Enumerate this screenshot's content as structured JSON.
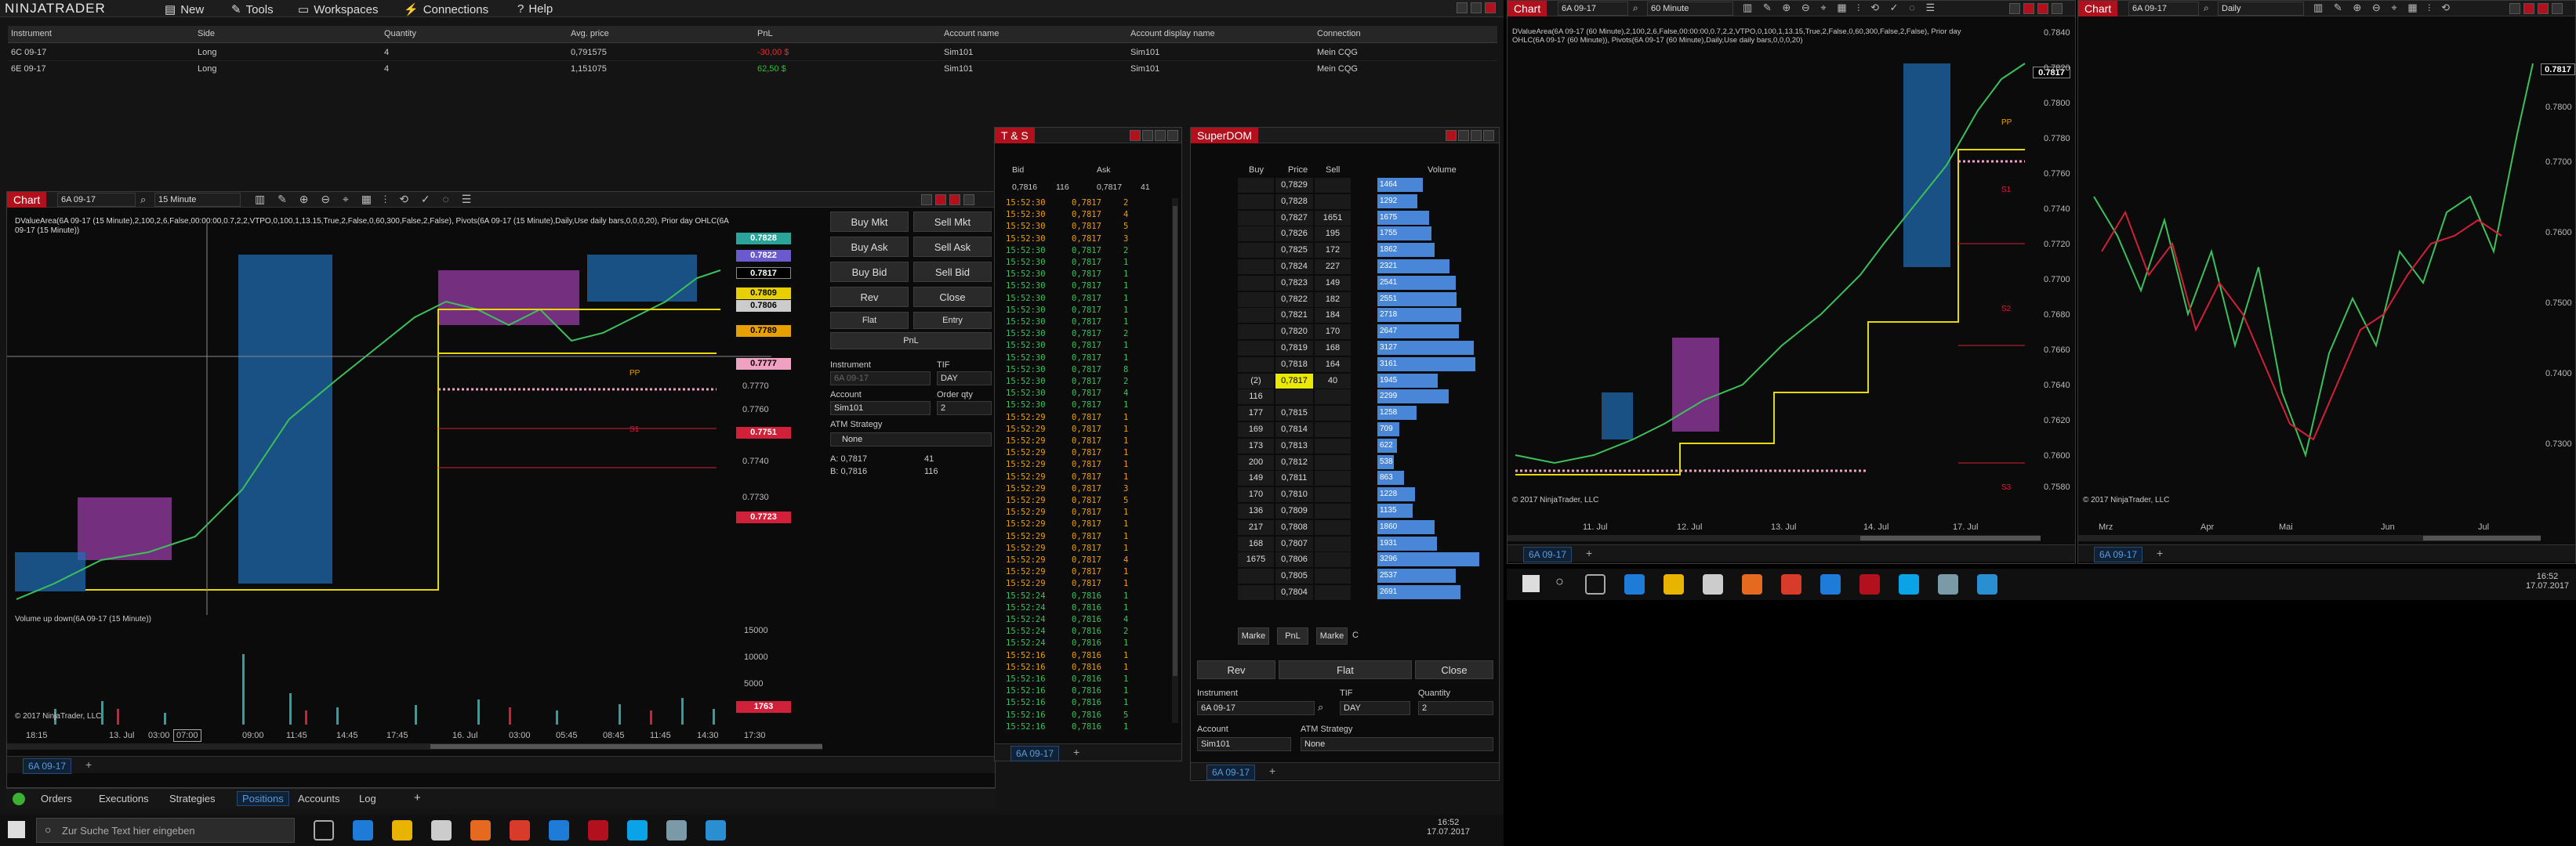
{
  "app": {
    "logo": "NINJATRADER",
    "menu": [
      "New",
      "Tools",
      "Workspaces",
      "Connections",
      "Help"
    ]
  },
  "positions": {
    "headers": [
      "Instrument",
      "Side",
      "Quantity",
      "Avg. price",
      "PnL",
      "Account name",
      "Account display name",
      "Connection"
    ],
    "rows": [
      [
        "6C 09-17",
        "Long",
        "4",
        "0,791575",
        "-30,00 $",
        "Sim101",
        "Sim101",
        "Mein CQG"
      ],
      [
        "6E 09-17",
        "Long",
        "4",
        "1,151075",
        "62,50 $",
        "Sim101",
        "Sim101",
        "Mein CQG"
      ]
    ]
  },
  "chart1": {
    "title": "Chart",
    "instrument": "6A 09-17",
    "interval": "15 Minute",
    "indicator_line": "DValueArea(6A 09-17 (15 Minute),2,100,2,6,False,00:00:00,0.7,2,2,VTPO,0,100,1,13.15,True,2,False,0,60,300,False,2,False), Pivots(6A 09-17 (15 Minute),Daily,Use daily bars,0,0,0,20), Prior day OHLC(6A",
    "indicator_line2": "09-17 (15 Minute))",
    "price_tags": [
      {
        "label": "0.7828",
        "color": "#2aa39a"
      },
      {
        "label": "0.7822",
        "color": "#6a5acd"
      },
      {
        "label": "0.7817",
        "color": "#000000"
      },
      {
        "label": "0.7809",
        "color": "#e8d000"
      },
      {
        "label": "0.7806",
        "color": "#cccccc"
      },
      {
        "label": "0.7789",
        "color": "#e8a000"
      },
      {
        "label": "0.7777",
        "color": "#f0a0c0"
      },
      {
        "label": "0.7751",
        "color": "#d0203a"
      },
      {
        "label": "0.7723",
        "color": "#d0203a"
      }
    ],
    "y_ticks": [
      "0.7770",
      "0.7760",
      "0.7750",
      "0.7740",
      "0.7730"
    ],
    "x_ticks": [
      "18:15",
      "13. Jul",
      "03:00",
      "07:00",
      "09:00",
      "11:45",
      "14:45",
      "17:45",
      "16. Jul",
      "03:00",
      "05:45",
      "08:45",
      "11:45",
      "14:30",
      "17:30"
    ],
    "pp_label": "PP",
    "s1_label": "S1",
    "volume_title": "Volume up down(6A 09-17 (15 Minute))",
    "vol_ticks": [
      "15000",
      "10000",
      "5000"
    ],
    "vol_tag": "1763",
    "copyright": "© 2017 NinjaTrader, LLC",
    "tab": "6A 09-17"
  },
  "chart_trader": {
    "buy_mkt": "Buy Mkt",
    "sell_mkt": "Sell Mkt",
    "buy_ask": "Buy Ask",
    "sell_ask": "Sell Ask",
    "buy_bid": "Buy Bid",
    "sell_bid": "Sell Bid",
    "rev": "Rev",
    "close": "Close",
    "flat": "Flat",
    "entry": "Entry",
    "pnl": "PnL",
    "instrument_label": "Instrument",
    "instrument_value": "6A 09-17",
    "tif_label": "TIF",
    "tif_value": "DAY",
    "account_label": "Account",
    "account_value": "Sim101",
    "order_qty_label": "Order qty",
    "order_qty_value": "2",
    "atm_label": "ATM Strategy",
    "atm_value": "None",
    "a_line": "A: 0,7817",
    "a_qty": "41",
    "b_line": "B: 0,7816",
    "b_qty": "116"
  },
  "bottom_tabs": [
    "Orders",
    "Executions",
    "Strategies",
    "Positions",
    "Accounts",
    "Log"
  ],
  "ts": {
    "title": "T & S",
    "bid_label": "Bid",
    "ask_label": "Ask",
    "bid_value": "0,7816",
    "bid_size": "116",
    "ask_value": "0,7817",
    "ask_size": "41",
    "rows": [
      [
        "15:52:30",
        "0,7817",
        "2",
        "o"
      ],
      [
        "15:52:30",
        "0,7817",
        "4",
        "o"
      ],
      [
        "15:52:30",
        "0,7817",
        "5",
        "o"
      ],
      [
        "15:52:30",
        "0,7817",
        "3",
        "o"
      ],
      [
        "15:52:30",
        "0,7817",
        "2",
        "g"
      ],
      [
        "15:52:30",
        "0,7817",
        "1",
        "g"
      ],
      [
        "15:52:30",
        "0,7817",
        "1",
        "g"
      ],
      [
        "15:52:30",
        "0,7817",
        "1",
        "g"
      ],
      [
        "15:52:30",
        "0,7817",
        "1",
        "g"
      ],
      [
        "15:52:30",
        "0,7817",
        "1",
        "g"
      ],
      [
        "15:52:30",
        "0,7817",
        "1",
        "g"
      ],
      [
        "15:52:30",
        "0,7817",
        "2",
        "g"
      ],
      [
        "15:52:30",
        "0,7817",
        "1",
        "g"
      ],
      [
        "15:52:30",
        "0,7817",
        "1",
        "g"
      ],
      [
        "15:52:30",
        "0,7817",
        "8",
        "g"
      ],
      [
        "15:52:30",
        "0,7817",
        "2",
        "g"
      ],
      [
        "15:52:30",
        "0,7817",
        "4",
        "g"
      ],
      [
        "15:52:30",
        "0,7817",
        "1",
        "g"
      ],
      [
        "15:52:29",
        "0,7817",
        "1",
        "o"
      ],
      [
        "15:52:29",
        "0,7817",
        "1",
        "o"
      ],
      [
        "15:52:29",
        "0,7817",
        "1",
        "o"
      ],
      [
        "15:52:29",
        "0,7817",
        "1",
        "o"
      ],
      [
        "15:52:29",
        "0,7817",
        "1",
        "o"
      ],
      [
        "15:52:29",
        "0,7817",
        "1",
        "o"
      ],
      [
        "15:52:29",
        "0,7817",
        "3",
        "o"
      ],
      [
        "15:52:29",
        "0,7817",
        "5",
        "o"
      ],
      [
        "15:52:29",
        "0,7817",
        "1",
        "o"
      ],
      [
        "15:52:29",
        "0,7817",
        "1",
        "o"
      ],
      [
        "15:52:29",
        "0,7817",
        "1",
        "o"
      ],
      [
        "15:52:29",
        "0,7817",
        "1",
        "o"
      ],
      [
        "15:52:29",
        "0,7817",
        "4",
        "o"
      ],
      [
        "15:52:29",
        "0,7817",
        "1",
        "o"
      ],
      [
        "15:52:29",
        "0,7817",
        "1",
        "o"
      ],
      [
        "15:52:24",
        "0,7816",
        "1",
        "g"
      ],
      [
        "15:52:24",
        "0,7816",
        "1",
        "g"
      ],
      [
        "15:52:24",
        "0,7816",
        "4",
        "g"
      ],
      [
        "15:52:24",
        "0,7816",
        "2",
        "g"
      ],
      [
        "15:52:24",
        "0,7816",
        "1",
        "g"
      ],
      [
        "15:52:16",
        "0,7816",
        "1",
        "o"
      ],
      [
        "15:52:16",
        "0,7816",
        "1",
        "o"
      ],
      [
        "15:52:16",
        "0,7816",
        "1",
        "g"
      ],
      [
        "15:52:16",
        "0,7816",
        "1",
        "g"
      ],
      [
        "15:52:16",
        "0,7816",
        "1",
        "g"
      ],
      [
        "15:52:16",
        "0,7816",
        "5",
        "g"
      ],
      [
        "15:52:16",
        "0,7816",
        "1",
        "g"
      ]
    ],
    "tab": "6A 09-17"
  },
  "dom": {
    "title": "SuperDOM",
    "col_buy": "Buy",
    "col_price": "Price",
    "col_sell": "Sell",
    "col_volume": "Volume",
    "rows": [
      {
        "buy": "",
        "price": "0,7829",
        "sell": "",
        "vol": "1464"
      },
      {
        "buy": "",
        "price": "0,7828",
        "sell": "",
        "vol": "1292"
      },
      {
        "buy": "",
        "price": "0,7827",
        "sell": "1651",
        "vol": "1675"
      },
      {
        "buy": "",
        "price": "0,7826",
        "sell": "195",
        "vol": "1755"
      },
      {
        "buy": "",
        "price": "0,7825",
        "sell": "172",
        "vol": "1862"
      },
      {
        "buy": "",
        "price": "0,7824",
        "sell": "227",
        "vol": "2321"
      },
      {
        "buy": "",
        "price": "0,7823",
        "sell": "149",
        "vol": "2541"
      },
      {
        "buy": "",
        "price": "0,7822",
        "sell": "182",
        "vol": "2551"
      },
      {
        "buy": "",
        "price": "0,7821",
        "sell": "184",
        "vol": "2718"
      },
      {
        "buy": "",
        "price": "0,7820",
        "sell": "170",
        "vol": "2647"
      },
      {
        "buy": "",
        "price": "0,7819",
        "sell": "168",
        "vol": "3127"
      },
      {
        "buy": "",
        "price": "0,7818",
        "sell": "164",
        "vol": "3161"
      },
      {
        "buy": "(2)",
        "price": "0,7817",
        "sell": "40",
        "vol": "1945"
      },
      {
        "buy": "116",
        "price": "",
        "sell": "",
        "vol": "2299"
      },
      {
        "buy": "177",
        "price": "0,7815",
        "sell": "",
        "vol": "1258"
      },
      {
        "buy": "169",
        "price": "0,7814",
        "sell": "",
        "vol": "709"
      },
      {
        "buy": "173",
        "price": "0,7813",
        "sell": "",
        "vol": "622"
      },
      {
        "buy": "200",
        "price": "0,7812",
        "sell": "",
        "vol": "538"
      },
      {
        "buy": "149",
        "price": "0,7811",
        "sell": "",
        "vol": "863"
      },
      {
        "buy": "170",
        "price": "0,7810",
        "sell": "",
        "vol": "1228"
      },
      {
        "buy": "136",
        "price": "0,7809",
        "sell": "",
        "vol": "1135"
      },
      {
        "buy": "217",
        "price": "0,7808",
        "sell": "",
        "vol": "1860"
      },
      {
        "buy": "168",
        "price": "0,7807",
        "sell": "",
        "vol": "1931"
      },
      {
        "buy": "1675",
        "price": "0,7806",
        "sell": "",
        "vol": "3296"
      },
      {
        "buy": "",
        "price": "0,7805",
        "sell": "",
        "vol": "2537"
      },
      {
        "buy": "",
        "price": "0,7804",
        "sell": "",
        "vol": "2691"
      }
    ],
    "footer_left": "Marke",
    "footer_pnl": "PnL",
    "footer_right": "Marke",
    "footer_c": "C",
    "rev": "Rev",
    "flat": "Flat",
    "close": "Close",
    "instrument_label": "Instrument",
    "instrument_value": "6A 09-17",
    "tif_label": "TIF",
    "tif_value": "DAY",
    "qty_label": "Quantity",
    "qty_value": "2",
    "account_label": "Account",
    "account_value": "Sim101",
    "atm_label": "ATM Strategy",
    "atm_value": "None",
    "tab": "6A 09-17"
  },
  "taskbar_left": {
    "search_placeholder": "Zur Suche Text hier eingeben",
    "time": "16:52",
    "date": "17.07.2017"
  },
  "chart2": {
    "title": "Chart",
    "instrument": "6A 09-17",
    "interval": "60 Minute",
    "indicator_line": "DValueArea(6A 09-17 (60 Minute),2,100,2,6,False,00:00:00,0.7,2,2,VTPO,0,100,1,13.15,True,2,False,0,60,300,False,2,False), Prior day",
    "indicator_line2": "OHLC(6A 09-17 (60 Minute)), Pivots(6A 09-17 (60 Minute),Daily,Use daily bars,0,0,0,20)",
    "y_ticks": [
      "0.7840",
      "0.7820",
      "0.7800",
      "0.7780",
      "0.7760",
      "0.7740",
      "0.7720",
      "0.7700",
      "0.7680",
      "0.7660",
      "0.7640",
      "0.7620",
      "0.7600",
      "0.7580"
    ],
    "price_tag": "0.7817",
    "x_ticks": [
      "11. Jul",
      "12. Jul",
      "13. Jul",
      "14. Jul",
      "17. Jul"
    ],
    "pp": "PP",
    "s1": "S1",
    "s2": "S2",
    "s3": "S3",
    "copyright": "© 2017 NinjaTrader, LLC",
    "tab": "6A 09-17"
  },
  "chart3": {
    "title": "Chart",
    "instrument": "6A 09-17",
    "interval": "Daily",
    "y_ticks": [
      "0.7800",
      "0.7700",
      "0.7600",
      "0.7500",
      "0.7400",
      "0.7300"
    ],
    "price_tag": "0.7817",
    "x_ticks": [
      "Mrz",
      "Apr",
      "Mai",
      "Jun",
      "Jul"
    ],
    "copyright": "© 2017 NinjaTrader, LLC",
    "tab": "6A 09-17"
  },
  "taskbar_right": {
    "time": "16:52",
    "date": "17.07.2017"
  }
}
